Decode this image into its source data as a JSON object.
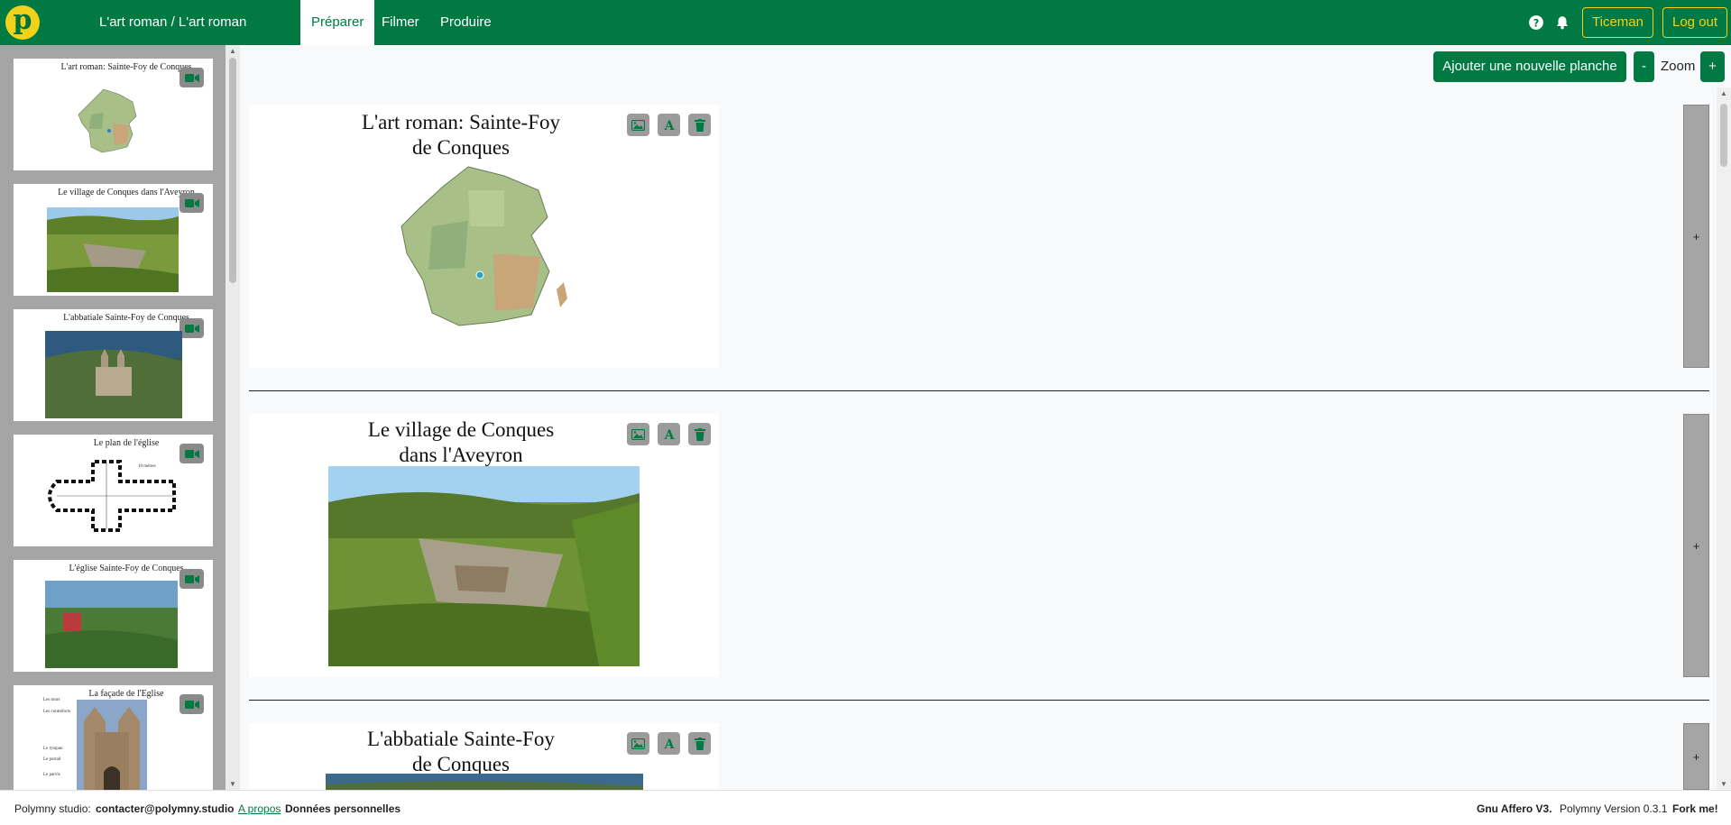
{
  "navbar": {
    "logo_letter": "p",
    "project_title": "L'art roman / L'art roman",
    "tabs": [
      "Préparer",
      "Filmer",
      "Produire"
    ],
    "help_icon": "help-circle-icon",
    "bell_icon": "bell-icon",
    "user_button": "Ticeman",
    "logout_button": "Log out"
  },
  "sidebar": {
    "slides": [
      {
        "title": "L'art roman: Sainte-Foy de Conques",
        "image": "map of France"
      },
      {
        "title": "Le village de Conques dans l'Aveyron",
        "image": "village photo"
      },
      {
        "title": "L'abbatiale Sainte-Foy de Conques",
        "image": "abbey photo"
      },
      {
        "title": "Le plan de l'église",
        "image": "church floor plan",
        "inner_label": "10 mètres"
      },
      {
        "title": "L'église Sainte-Foy de Conques",
        "image": "church photo"
      },
      {
        "title": "La façade de l'Eglise",
        "image": "facade photo",
        "labels": [
          "Les tours",
          "Les contreforts",
          "Le tympan",
          "Le portail",
          "Le parvis"
        ]
      }
    ]
  },
  "toolbar": {
    "add_slide_button": "Ajouter une nouvelle planche",
    "zoom_minus": "-",
    "zoom_label": "Zoom",
    "zoom_plus": "+"
  },
  "slides": [
    {
      "title": "L'art roman: Sainte-Foy de Conques",
      "add": "+"
    },
    {
      "title": "Le village de Conques dans l'Aveyron",
      "add": "+"
    },
    {
      "title": "L'abbatiale Sainte-Foy de Conques",
      "add": "+"
    }
  ],
  "footer": {
    "studio_label": "Polymny studio:",
    "email": "contacter@polymny.studio",
    "about_link": "A propos",
    "privacy": "Données personnelles",
    "license": "Gnu Affero V3.",
    "version": "Polymny Version 0.3.1",
    "fork": "Fork me!"
  },
  "colors": {
    "brand_green": "#007a42",
    "brand_yellow": "#f2d11a",
    "sidebar_gray": "#a5a5a5"
  }
}
